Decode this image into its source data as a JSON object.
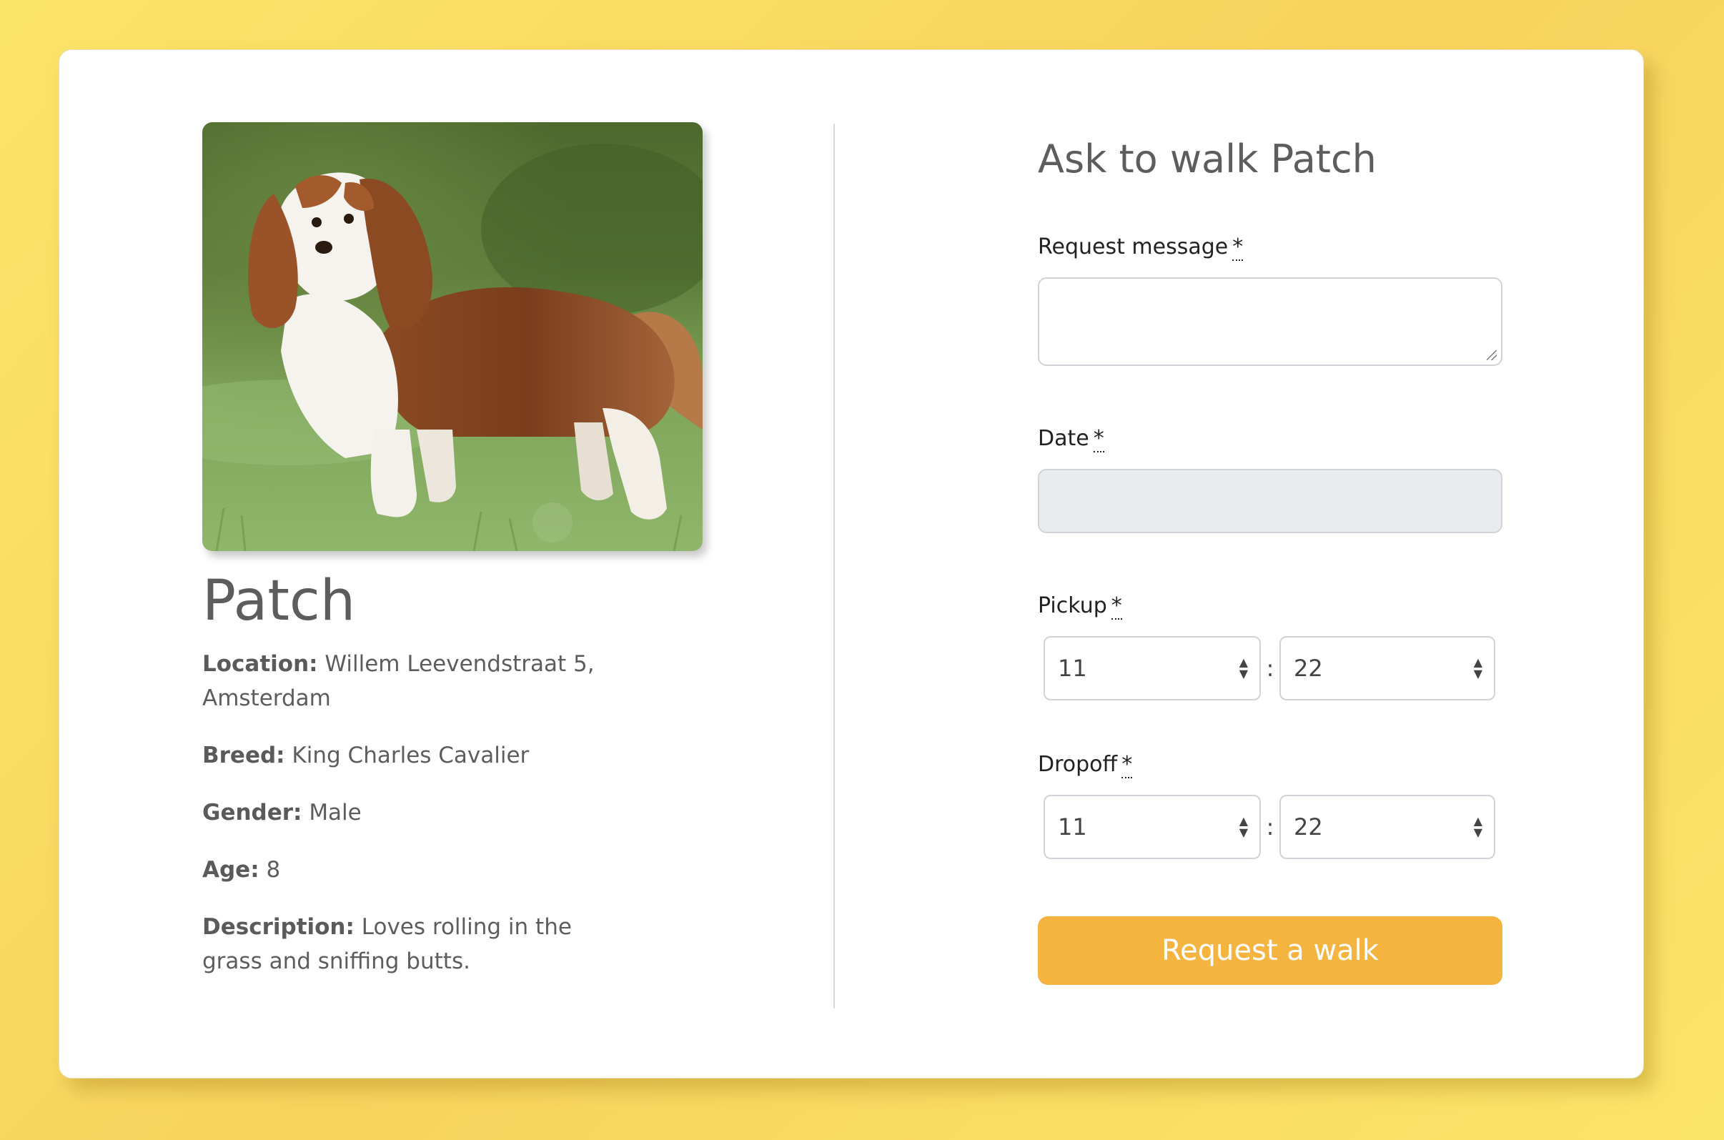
{
  "dog": {
    "name": "Patch",
    "photo_alt": "King Charles Cavalier dog standing in the grass",
    "details": [
      {
        "label": "Location:",
        "value": "Willem Leevendstraat 5, Amsterdam"
      },
      {
        "label": "Breed:",
        "value": "King Charles Cavalier"
      },
      {
        "label": "Gender:",
        "value": "Male"
      },
      {
        "label": "Age:",
        "value": "8"
      },
      {
        "label": "Description:",
        "value": "Loves rolling in the grass and sniffing butts."
      }
    ]
  },
  "form": {
    "title": "Ask to walk Patch",
    "required_marker": "*",
    "message": {
      "label": "Request message",
      "value": ""
    },
    "date": {
      "label": "Date",
      "value": ""
    },
    "pickup": {
      "label": "Pickup",
      "hour": "11",
      "minute": "22"
    },
    "dropoff": {
      "label": "Dropoff",
      "hour": "11",
      "minute": "22"
    },
    "time_separator": ":",
    "submit_label": "Request a walk"
  },
  "colors": {
    "background": "#fbe46a",
    "card": "#ffffff",
    "accent": "#f4b43f",
    "text": "#5d5d5d",
    "disabled_input": "#e9ecef"
  }
}
